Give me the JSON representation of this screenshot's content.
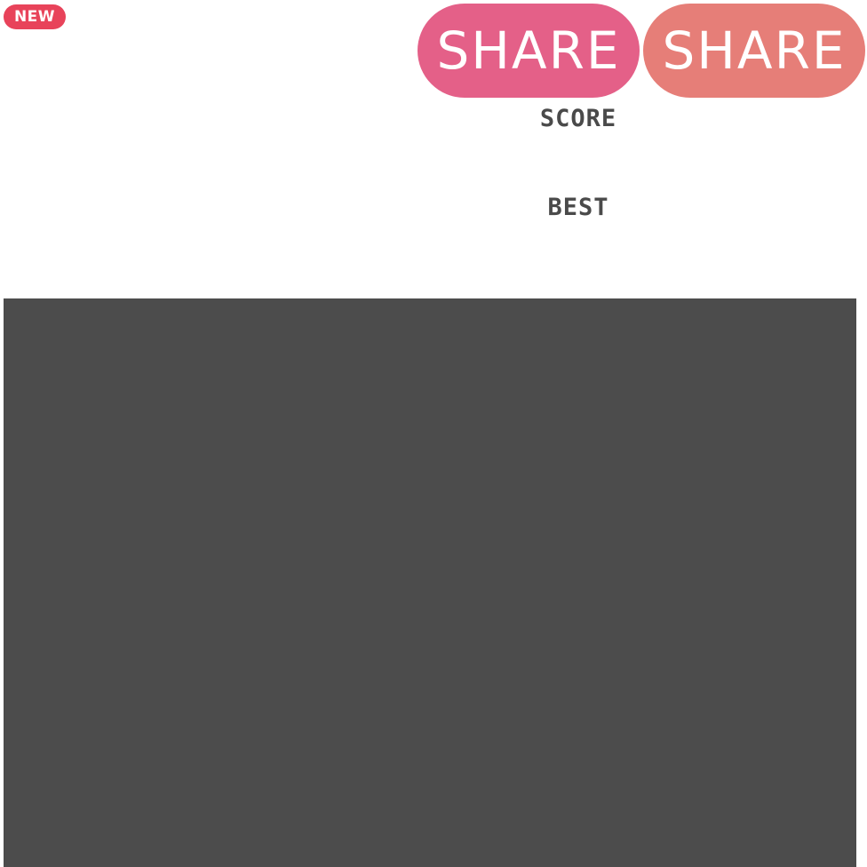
{
  "header": {
    "new_badge": "NEW",
    "share_buttons": [
      {
        "label": "SHARE"
      },
      {
        "label": "SHARE"
      }
    ],
    "score_label": "SCORE",
    "best_label": "BEST"
  },
  "colors": {
    "new_badge_bg": "#e8435a",
    "share_button_1_bg": "#e46088",
    "share_button_2_bg": "#e67e78",
    "stat_label_text": "#4a4a4a",
    "board_bg": "#4c4c4c",
    "page_bg": "#ffffff"
  }
}
